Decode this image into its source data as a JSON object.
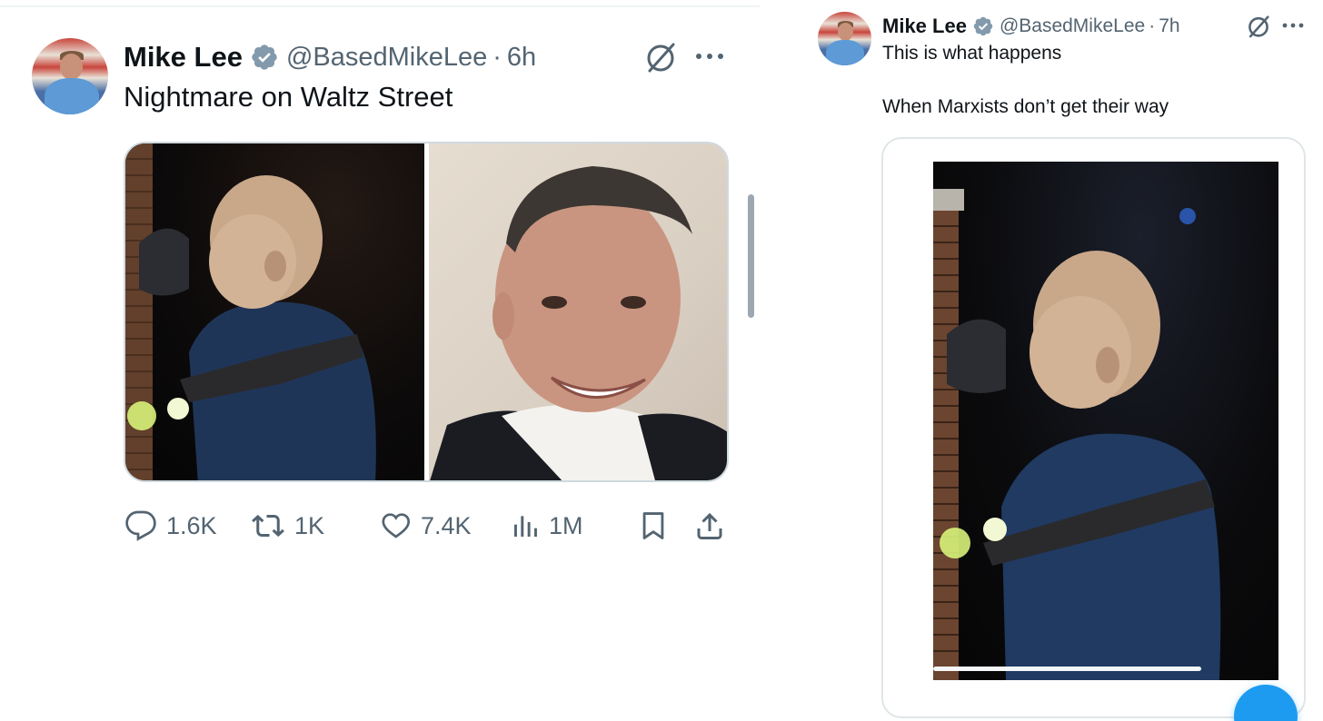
{
  "left_tweet": {
    "author_name": "Mike Lee",
    "author_handle": "@BasedMikeLee",
    "time_separator": "·",
    "timestamp": "6h",
    "text": "Nightmare on Waltz Street",
    "media_count": 2,
    "stats": {
      "replies": "1.6K",
      "reposts": "1K",
      "likes": "7.4K",
      "views": "1M"
    }
  },
  "right_tweet": {
    "author_name": "Mike Lee",
    "author_handle": "@BasedMikeLee",
    "time_separator": "·",
    "timestamp": "7h",
    "text_line1": "This is what happens",
    "text_line2": "When Marxists don’t get their way",
    "media_type": "video"
  },
  "icons": {
    "verified": "verified-badge-icon",
    "grok": "grok-icon",
    "more": "more-icon",
    "reply": "reply-icon",
    "repost": "repost-icon",
    "like": "like-icon",
    "views": "views-icon",
    "bookmark": "bookmark-icon",
    "share": "share-icon"
  },
  "colors": {
    "text_primary": "#0f1419",
    "text_secondary": "#536471",
    "verified_badge": "#829aab",
    "accent_blue": "#1d9bf0",
    "border": "#cfd9de"
  }
}
